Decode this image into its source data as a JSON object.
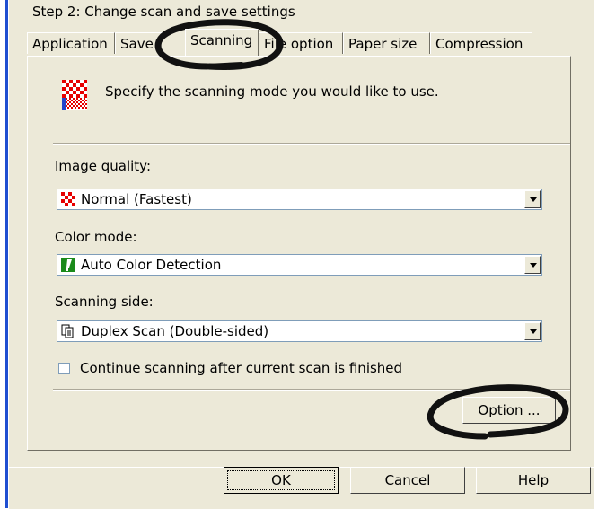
{
  "step_title": "Step 2: Change scan and save settings",
  "tabs": [
    {
      "label": "Application"
    },
    {
      "label": "Save"
    },
    {
      "label": "Scanning"
    },
    {
      "label": "File option"
    },
    {
      "label": "Paper size"
    },
    {
      "label": "Compression"
    }
  ],
  "active_tab": "Scanning",
  "header_text": "Specify the scanning mode you would like to use.",
  "image_quality": {
    "label": "Image quality:",
    "value": "Normal (Fastest)",
    "icon": "checker-icon"
  },
  "color_mode": {
    "label": "Color mode:",
    "value": "Auto Color Detection",
    "icon": "exclamation-icon"
  },
  "scanning_side": {
    "label": "Scanning side:",
    "value": "Duplex Scan (Double-sided)",
    "icon": "duplex-page-icon"
  },
  "continue_scanning": {
    "label": "Continue scanning after current scan is finished",
    "checked": false
  },
  "option_button": "Option ...",
  "footer": {
    "ok": "OK",
    "cancel": "Cancel",
    "help": "Help"
  },
  "colors": {
    "window": "#ece9d8",
    "accent": "#1f4fd1",
    "icon_red": "#e60000",
    "icon_green": "#1a8a1a"
  }
}
